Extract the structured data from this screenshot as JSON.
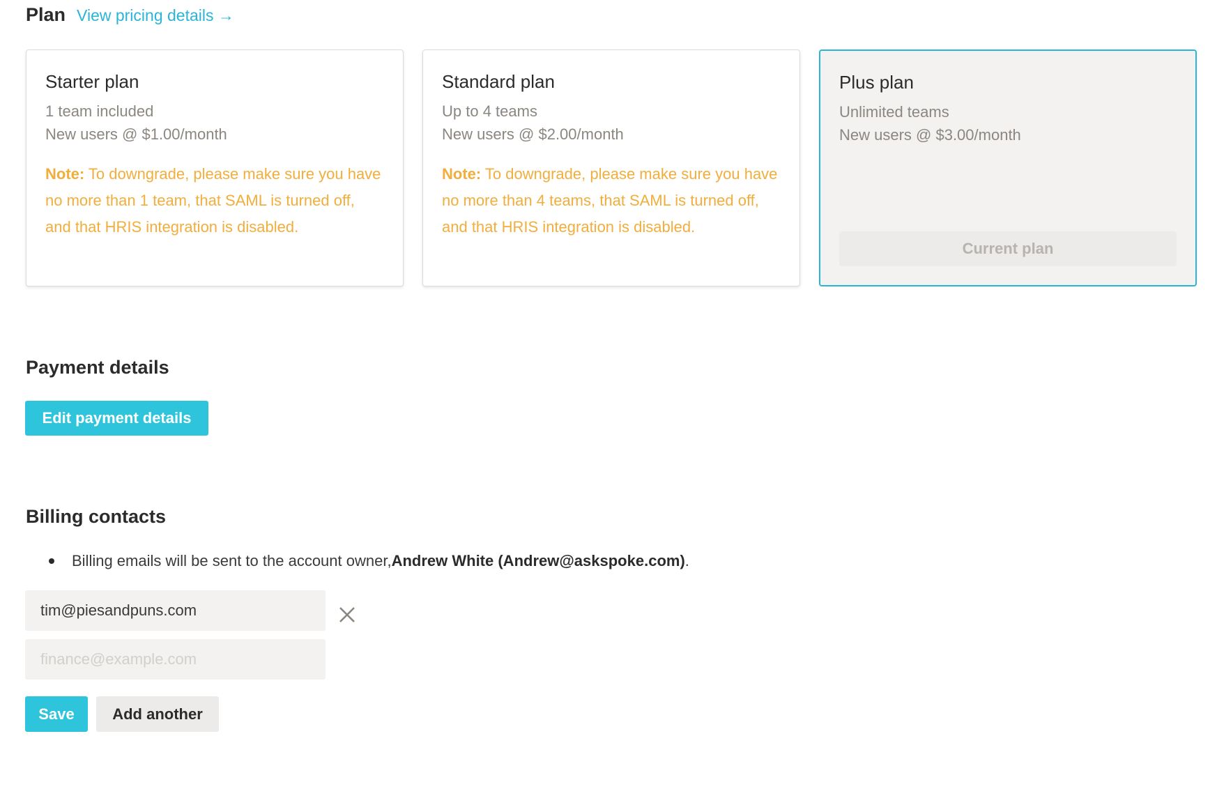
{
  "plan": {
    "title": "Plan",
    "pricing_link": "View pricing details →",
    "cards": [
      {
        "name": "Starter plan",
        "line1": "1 team included",
        "line2": "New users @ $1.00/month",
        "note_label": "Note:",
        "note_text": " To downgrade, please make sure you have no more than 1 team, that SAML is turned off, and that HRIS integration is disabled."
      },
      {
        "name": "Standard plan",
        "line1": "Up to 4 teams",
        "line2": "New users @ $2.00/month",
        "note_label": "Note:",
        "note_text": " To downgrade, please make sure you have no more than 4 teams, that SAML is turned off, and that HRIS integration is disabled."
      },
      {
        "name": "Plus plan",
        "line1": "Unlimited teams",
        "line2": "New users @ $3.00/month",
        "current_label": "Current plan"
      }
    ]
  },
  "payment": {
    "title": "Payment details",
    "edit_button": "Edit payment details"
  },
  "billing": {
    "title": "Billing contacts",
    "info_prefix": "Billing emails will be sent to the account owner, ",
    "owner": "Andrew White (Andrew@askspoke.com)",
    "info_suffix": ".",
    "email_value": "tim@piesandpuns.com",
    "email_placeholder": "finance@example.com",
    "save_button": "Save",
    "add_button": "Add another"
  },
  "colors": {
    "accent": "#2ec5dc",
    "link": "#2ab5d6",
    "note": "#f2ae3c",
    "muted": "#8b8680"
  }
}
